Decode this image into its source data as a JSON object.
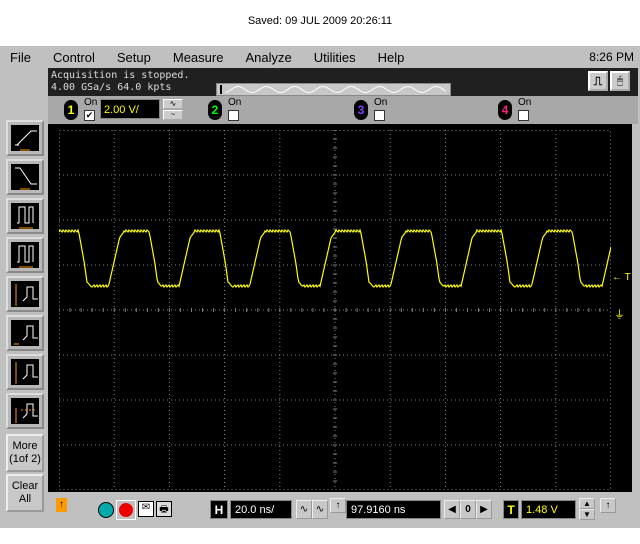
{
  "header": {
    "saved_text": "Saved:  09 JUL 2009  20:26:11"
  },
  "menu": {
    "items": [
      "File",
      "Control",
      "Setup",
      "Measure",
      "Analyze",
      "Utilities",
      "Help"
    ],
    "clock": "8:26 PM"
  },
  "status": {
    "line1": "Acquisition is stopped.",
    "line2": "4.00 GSa/s   64.0 kpts"
  },
  "channels": [
    {
      "num": "1",
      "on_label": "On",
      "checked": true,
      "color": "#ffff00",
      "scale": "2.00 V/"
    },
    {
      "num": "2",
      "on_label": "On",
      "checked": false,
      "color": "#00ff00"
    },
    {
      "num": "3",
      "on_label": "On",
      "checked": false,
      "color": "#8040ff"
    },
    {
      "num": "4",
      "on_label": "On",
      "checked": false,
      "color": "#ff2080"
    }
  ],
  "left_buttons": {
    "more": "More (1of 2)",
    "clear": "Clear All"
  },
  "markers": {
    "trigger": "← T"
  },
  "bottom": {
    "h_label": "H",
    "timebase": "20.0 ns/",
    "delay": "97.9160 ns",
    "ref": "0",
    "t_label": "T",
    "trigger_level": "1.48 V"
  },
  "colors": {
    "trace": "#ffff00",
    "grid": "#808080"
  }
}
